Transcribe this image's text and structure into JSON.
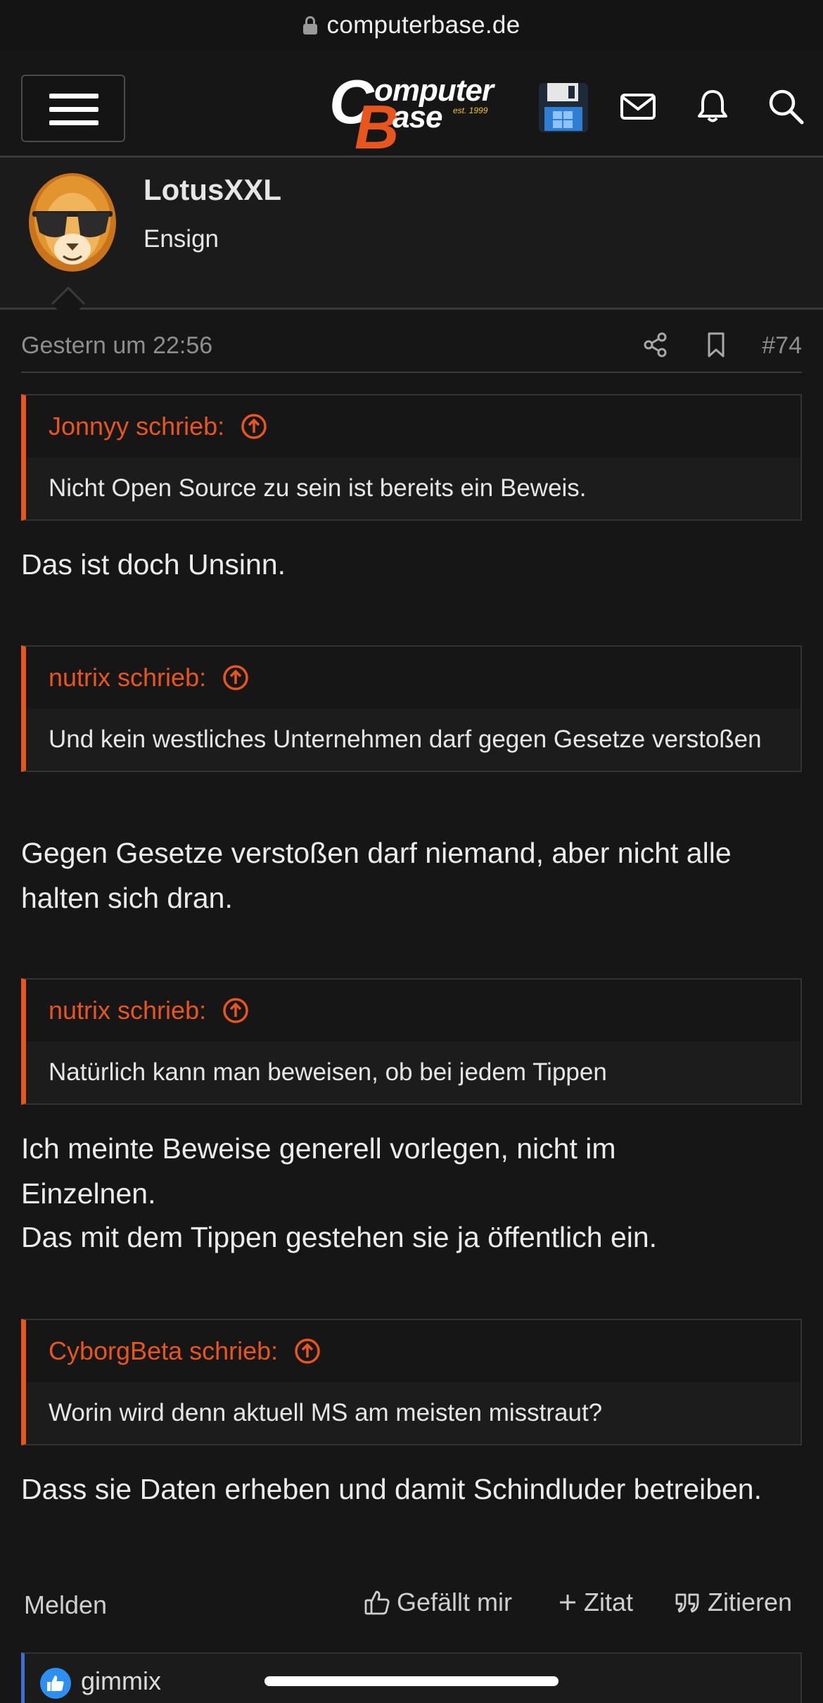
{
  "browser": {
    "url": "computerbase.de"
  },
  "header": {
    "logo": {
      "c": "C",
      "omputer": "omputer",
      "b": "B",
      "ase": "ase",
      "est": "est. 1999"
    }
  },
  "author": {
    "name": "LotusXXL",
    "rank": "Ensign"
  },
  "post": {
    "time": "Gestern um 22:56",
    "number": "#74",
    "blocks": [
      {
        "quote_author": "Jonnyy schrieb:",
        "quote_text": "Nicht Open Source zu sein ist bereits ein Beweis.",
        "reply": "Das ist doch Unsinn."
      },
      {
        "quote_author": "nutrix schrieb:",
        "quote_text": "Und kein westliches Unternehmen darf gegen Gesetze verstoßen",
        "reply": "Gegen Gesetze verstoßen darf niemand, aber nicht alle halten sich dran."
      },
      {
        "quote_author": "nutrix schrieb:",
        "quote_text": "Natürlich kann man beweisen, ob bei jedem Tippen",
        "reply_line1": "Ich meinte Beweise generell vorlegen, nicht im Einzelnen.",
        "reply_line2": "Das mit dem Tippen gestehen sie ja öffentlich ein."
      },
      {
        "quote_author": "CyborgBeta schrieb:",
        "quote_text": "Worin wird denn aktuell MS am meisten misstraut?",
        "reply": "Dass sie Daten erheben und damit Schindluder betreiben."
      }
    ]
  },
  "actions": {
    "report": "Melden",
    "like": "Gefällt mir",
    "add_quote": "Zitat",
    "quote": "Zitieren"
  },
  "reactions": {
    "users": "gimmix"
  },
  "colors": {
    "accent": "#e8561e",
    "background": "#161616",
    "like_blue": "#2d8ff2"
  }
}
